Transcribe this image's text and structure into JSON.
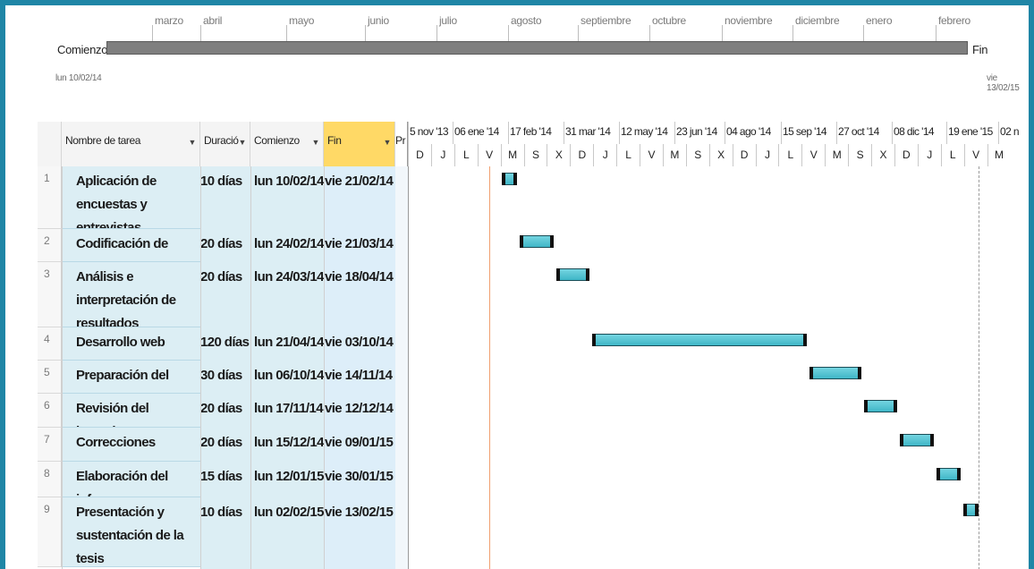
{
  "timeline": {
    "months": [
      "marzo",
      "abril",
      "mayo",
      "junio",
      "julio",
      "agosto",
      "septiembre",
      "octubre",
      "noviembre",
      "diciembre",
      "enero",
      "febrero"
    ],
    "start_label": "Comienzo",
    "start_date": "lun 10/02/14",
    "end_label": "Fin",
    "end_date": "vie 13/02/15"
  },
  "table": {
    "headers": {
      "name": "Nombre de tarea",
      "duration": "Duració",
      "start": "Comienzo",
      "end": "Fin",
      "predecessors": "Pr"
    },
    "rows": [
      {
        "id": "1",
        "name": "Aplicación de encuestas y entrevistas",
        "duration": "10 días",
        "start": "lun 10/02/14",
        "end": "vie 21/02/14"
      },
      {
        "id": "2",
        "name": "Codificación de datos",
        "duration": "20 días",
        "start": "lun 24/02/14",
        "end": "vie 21/03/14"
      },
      {
        "id": "3",
        "name": "Análisis e interpretación de resultados",
        "duration": "20 días",
        "start": "lun 24/03/14",
        "end": "vie 18/04/14"
      },
      {
        "id": "4",
        "name": "Desarrollo web",
        "duration": "120 días",
        "start": "lun 21/04/14",
        "end": "vie 03/10/14"
      },
      {
        "id": "5",
        "name": "Preparación del borrado",
        "duration": "30 días",
        "start": "lun 06/10/14",
        "end": "vie 14/11/14"
      },
      {
        "id": "6",
        "name": "Revisión del borrador",
        "duration": "20 días",
        "start": "lun 17/11/14",
        "end": "vie 12/12/14"
      },
      {
        "id": "7",
        "name": "Correcciones",
        "duration": "20 días",
        "start": "lun 15/12/14",
        "end": "vie 09/01/15"
      },
      {
        "id": "8",
        "name": "Elaboración del informe",
        "duration": "15 días",
        "start": "lun 12/01/15",
        "end": "vie 30/01/15"
      },
      {
        "id": "9",
        "name": "Presentación y sustentación de la tesis",
        "duration": "10 días",
        "start": "lun 02/02/15",
        "end": "vie 13/02/15"
      }
    ]
  },
  "gantt": {
    "periods": [
      "5 nov '13",
      "06 ene '14",
      "17 feb '14",
      "31 mar '14",
      "12 may '14",
      "23 jun '14",
      "04 ago '14",
      "15 sep '14",
      "27 oct '14",
      "08 dic '14",
      "19 ene '15",
      "02 n"
    ],
    "days": [
      "D",
      "J",
      "L",
      "V",
      "M",
      "S",
      "X",
      "D",
      "J",
      "L",
      "V",
      "M",
      "S",
      "X",
      "D",
      "J",
      "L",
      "V",
      "M",
      "S",
      "X",
      "D",
      "J",
      "L",
      "V",
      "M"
    ]
  },
  "colors": {
    "frame": "#1f86a6",
    "bar": "#3fb6c7",
    "table_highlight": "#dceef4",
    "fin_header": "#ffd966"
  }
}
